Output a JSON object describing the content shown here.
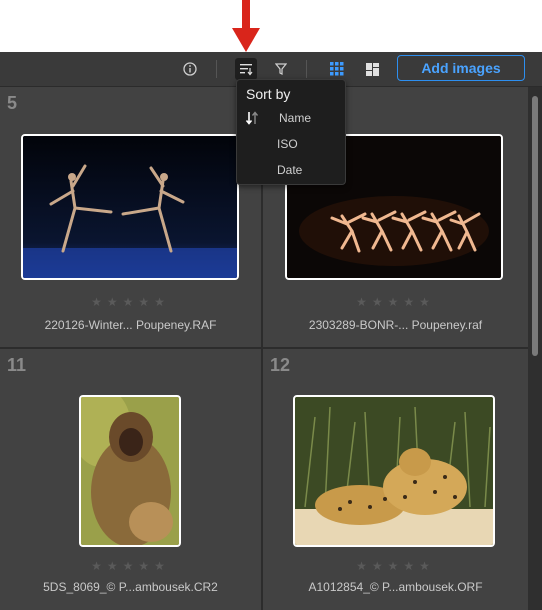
{
  "toolbar": {
    "add_images_label": "Add images",
    "icons": [
      "info-icon",
      "sort-icon",
      "filter-icon",
      "grid-view-icon",
      "mosaic-view-icon"
    ]
  },
  "sort_menu": {
    "title": "Sort by",
    "items": [
      {
        "label": "Name",
        "active": true
      },
      {
        "label": "ISO",
        "active": false
      },
      {
        "label": "Date",
        "active": false
      }
    ]
  },
  "cells": [
    {
      "number": "5",
      "filename": "220126-Winter... Poupeney.RAF",
      "stars": "★★★★★"
    },
    {
      "number": "",
      "filename": "2303289-BONR-... Poupeney.raf",
      "stars": "★★★★★"
    },
    {
      "number": "11",
      "filename": "5DS_8069_© P...ambousek.CR2",
      "stars": "★★★★★"
    },
    {
      "number": "12",
      "filename": "A1012854_© P...ambousek.ORF",
      "stars": "★★★★★"
    }
  ],
  "colors": {
    "accent": "#2d8ff0",
    "arrow": "#d9251b"
  }
}
